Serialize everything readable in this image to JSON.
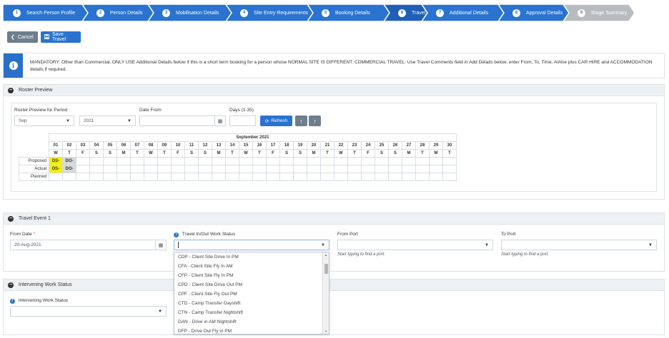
{
  "stepper": {
    "steps": [
      {
        "num": "1",
        "label": "Search Person Profile"
      },
      {
        "num": "2",
        "label": "Person Details"
      },
      {
        "num": "3",
        "label": "Mobilisation Details"
      },
      {
        "num": "4",
        "label": "Site Entry Requirements"
      },
      {
        "num": "5",
        "label": "Booking Details"
      },
      {
        "num": "6",
        "label": "Travel"
      },
      {
        "num": "7",
        "label": "Additional Details"
      },
      {
        "num": "8",
        "label": "Approval Details"
      },
      {
        "num": "9",
        "label": "Stage Summary"
      }
    ],
    "colors": {
      "done": "#2a73d0",
      "active": "#1f5fb8",
      "pending": "#b8bcc0"
    }
  },
  "toolbar": {
    "cancel_label": "Cancel",
    "save_label": "Save Travel"
  },
  "banner": {
    "text": "MANDATORY: Other than Commercial, ONLY USE Additional Details below if this is a short term booking for a person whose NORMAL SITE IS DIFFERENT. COMMERCIAL TRAVEL: Use Travel Comments field in Add Details below; enter From, To, Time, Airline plus CAR HIRE and ACCOMMODATION details if required."
  },
  "roster": {
    "panel_title": "Roster Preview",
    "period_label": "Roster Preview for Period",
    "month_value": "Sep",
    "year_value": "2021",
    "date_from_label": "Date From",
    "date_from_value": "",
    "days_label": "Days (1-35)",
    "days_value": "",
    "refresh_label": "Refresh",
    "month_header": "September 2021",
    "dates": [
      "01",
      "02",
      "03",
      "04",
      "05",
      "06",
      "07",
      "08",
      "09",
      "10",
      "11",
      "12",
      "13",
      "14",
      "15",
      "16",
      "17",
      "18",
      "19",
      "20",
      "21",
      "22",
      "23",
      "24",
      "25",
      "26",
      "27",
      "28",
      "29",
      "30"
    ],
    "weekdays": [
      "W",
      "T",
      "F",
      "S",
      "S",
      "M",
      "T",
      "W",
      "T",
      "F",
      "S",
      "S",
      "M",
      "T",
      "W",
      "T",
      "F",
      "S",
      "S",
      "M",
      "T",
      "W",
      "T",
      "F",
      "S",
      "S",
      "M",
      "T",
      "W",
      "T"
    ],
    "rows": [
      {
        "label": "Proposed",
        "cells": [
          "DS-",
          "DO-"
        ]
      },
      {
        "label": "Actual",
        "cells": [
          "DS-",
          "DO-"
        ]
      },
      {
        "label": "Planned",
        "cells": []
      }
    ]
  },
  "travel_event": {
    "panel_title": "Travel Event 1",
    "from_date_label": "From Date",
    "required_mark": "*",
    "from_date_value": "20-Aug-2021",
    "work_status_label": "Travel In/Out Work Status",
    "work_status_value": "",
    "from_port_label": "From Port",
    "from_port_hint": "Start typing to find a port.",
    "to_port_label": "To Port",
    "to_port_hint": "Start typing to find a port.",
    "options": [
      "CDP - Client Site Drive In PM",
      "CFA - Client Site Fly In AM",
      "CFP - Client Site Fly In PM",
      "CPD - Client Site Drive Out PM",
      "CPF - Client Site Fly Out PM",
      "CTD - Camp Transfer Dayshift",
      "CTN - Camp Transfer Nightshift",
      "DAN - Drive in AM Nightshift",
      "DFP - Drive Out Fly in PM"
    ]
  },
  "intervening": {
    "panel_title": "Intervening Work Status",
    "field_label": "Intervening Work Status",
    "value": ""
  }
}
